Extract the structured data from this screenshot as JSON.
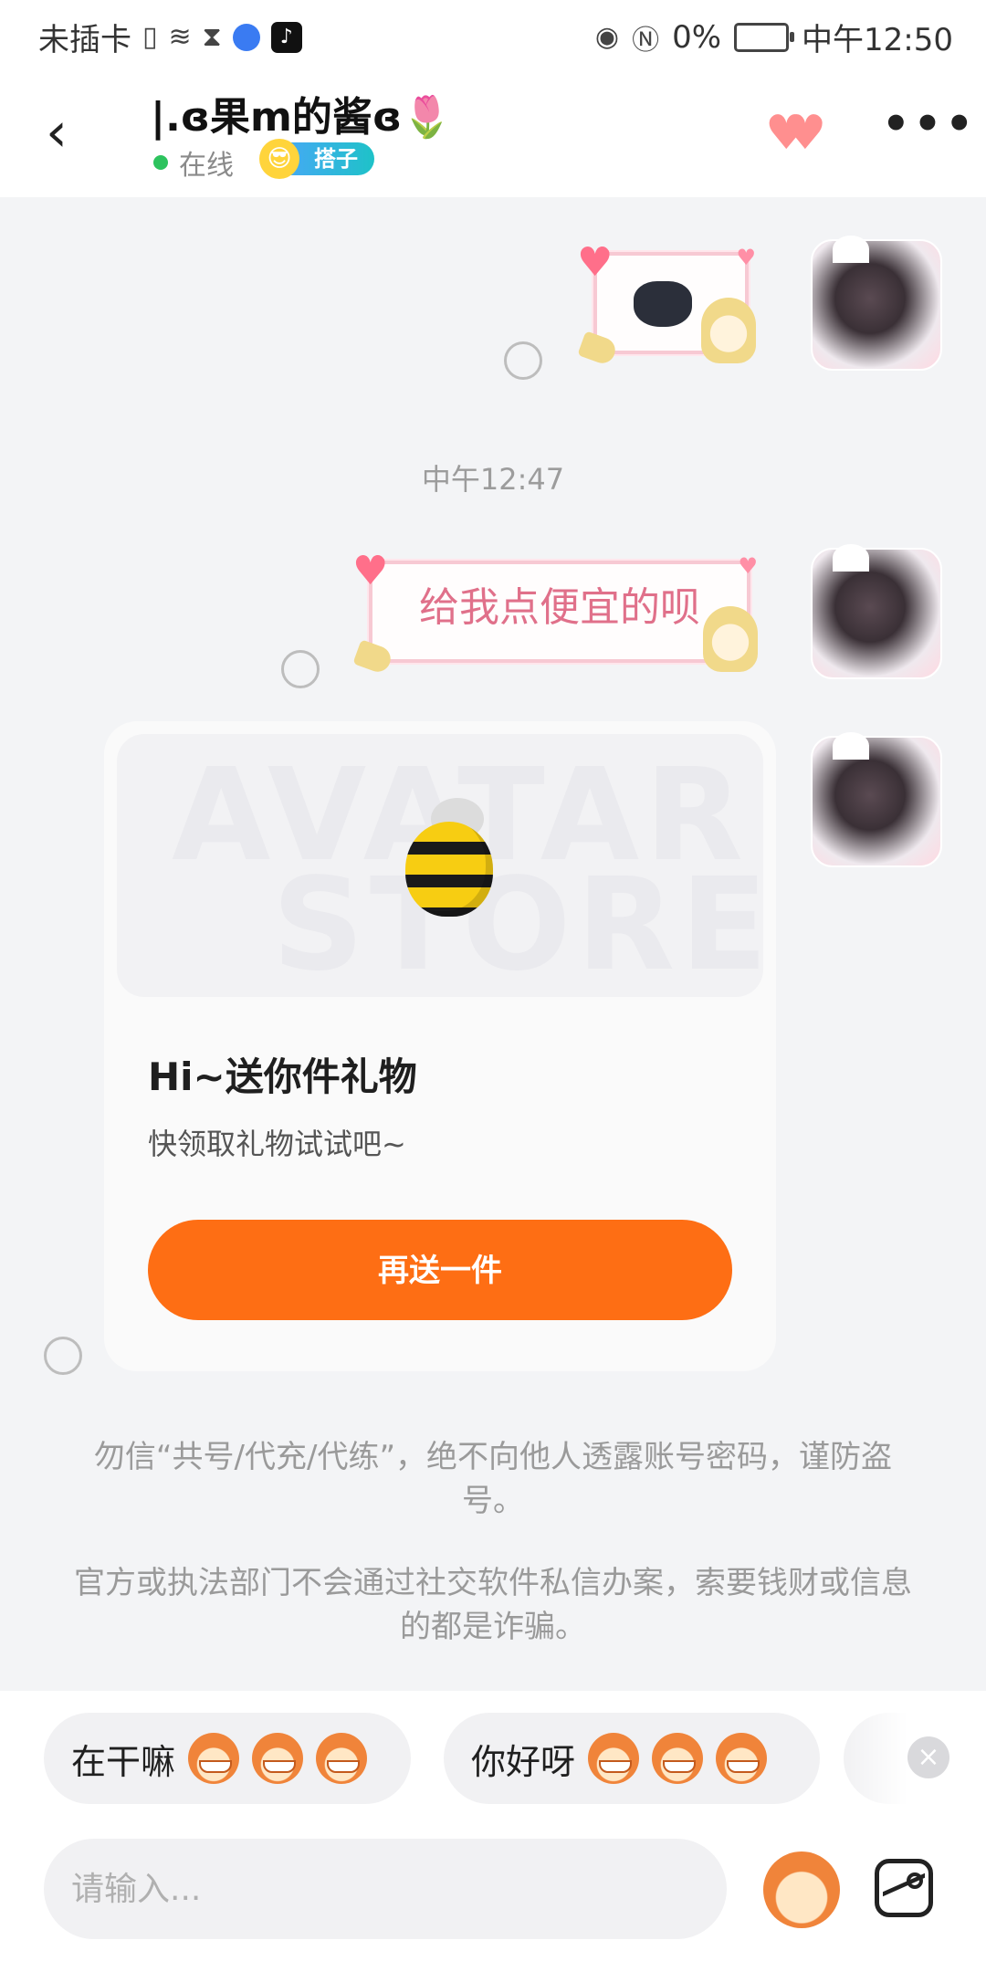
{
  "status_bar": {
    "carrier": "未插卡",
    "battery_percent": "0%",
    "time": "中午12:50"
  },
  "header": {
    "back_label": "‹",
    "title": "|.ɞ果m的酱ɞ🌷",
    "online_status": "在线",
    "partner_badge": "搭子",
    "more_label": "•••"
  },
  "messages": {
    "time_separator": "中午12:47",
    "sticker_text": "给我点便宜的呗",
    "gift_card": {
      "banner_watermark_line1": "AVATAR",
      "banner_watermark_line2": "STORE",
      "title": "Hi~送你件礼物",
      "subtitle": "快领取礼物试试吧~",
      "button_label": "再送一件"
    }
  },
  "notices": [
    "勿信“共号/代充/代练”，绝不向他人透露账号密码，谨防盗号。",
    "官方或执法部门不会通过社交软件私信办案，索要钱财或信息的都是诈骗。"
  ],
  "quick_replies": [
    {
      "label": "在干嘛"
    },
    {
      "label": "你好呀"
    }
  ],
  "input": {
    "placeholder": "请输入..."
  },
  "colors": {
    "accent_orange": "#fe6e14",
    "online_green": "#2dc35e",
    "sticker_pink": "#e0708a"
  }
}
